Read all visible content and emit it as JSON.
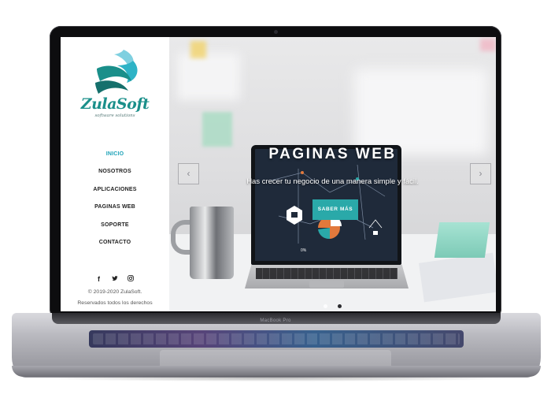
{
  "device": {
    "model_label": "MacBook Pro"
  },
  "brand": {
    "name": "ZulaSoft",
    "tagline": "software solutions",
    "colors": {
      "primary": "#1a8f8a",
      "accent": "#1fa3b8",
      "cta": "#2aa9a9"
    }
  },
  "nav": {
    "items": [
      {
        "label": "INICIO",
        "active": true
      },
      {
        "label": "NOSOTROS",
        "active": false
      },
      {
        "label": "APLICACIONES",
        "active": false
      },
      {
        "label": "PAGINAS WEB",
        "active": false
      },
      {
        "label": "SOPORTE",
        "active": false
      },
      {
        "label": "CONTACTO",
        "active": false
      }
    ]
  },
  "social": {
    "facebook": "f",
    "twitter": "🐦",
    "instagram": "◎"
  },
  "footer": {
    "copyright": "© 2019-2020 ZulaSoft.",
    "rights": "Reservados todos los derechos"
  },
  "hero": {
    "title": "PAGINAS WEB",
    "subtitle": "Has crecer tu negocio de una manera simple y fácil.",
    "cta_label": "SABER MÁS",
    "arrow_left": "‹",
    "arrow_right": "›",
    "slides": 2,
    "active_slide": 2,
    "screen_stat": "0%"
  }
}
